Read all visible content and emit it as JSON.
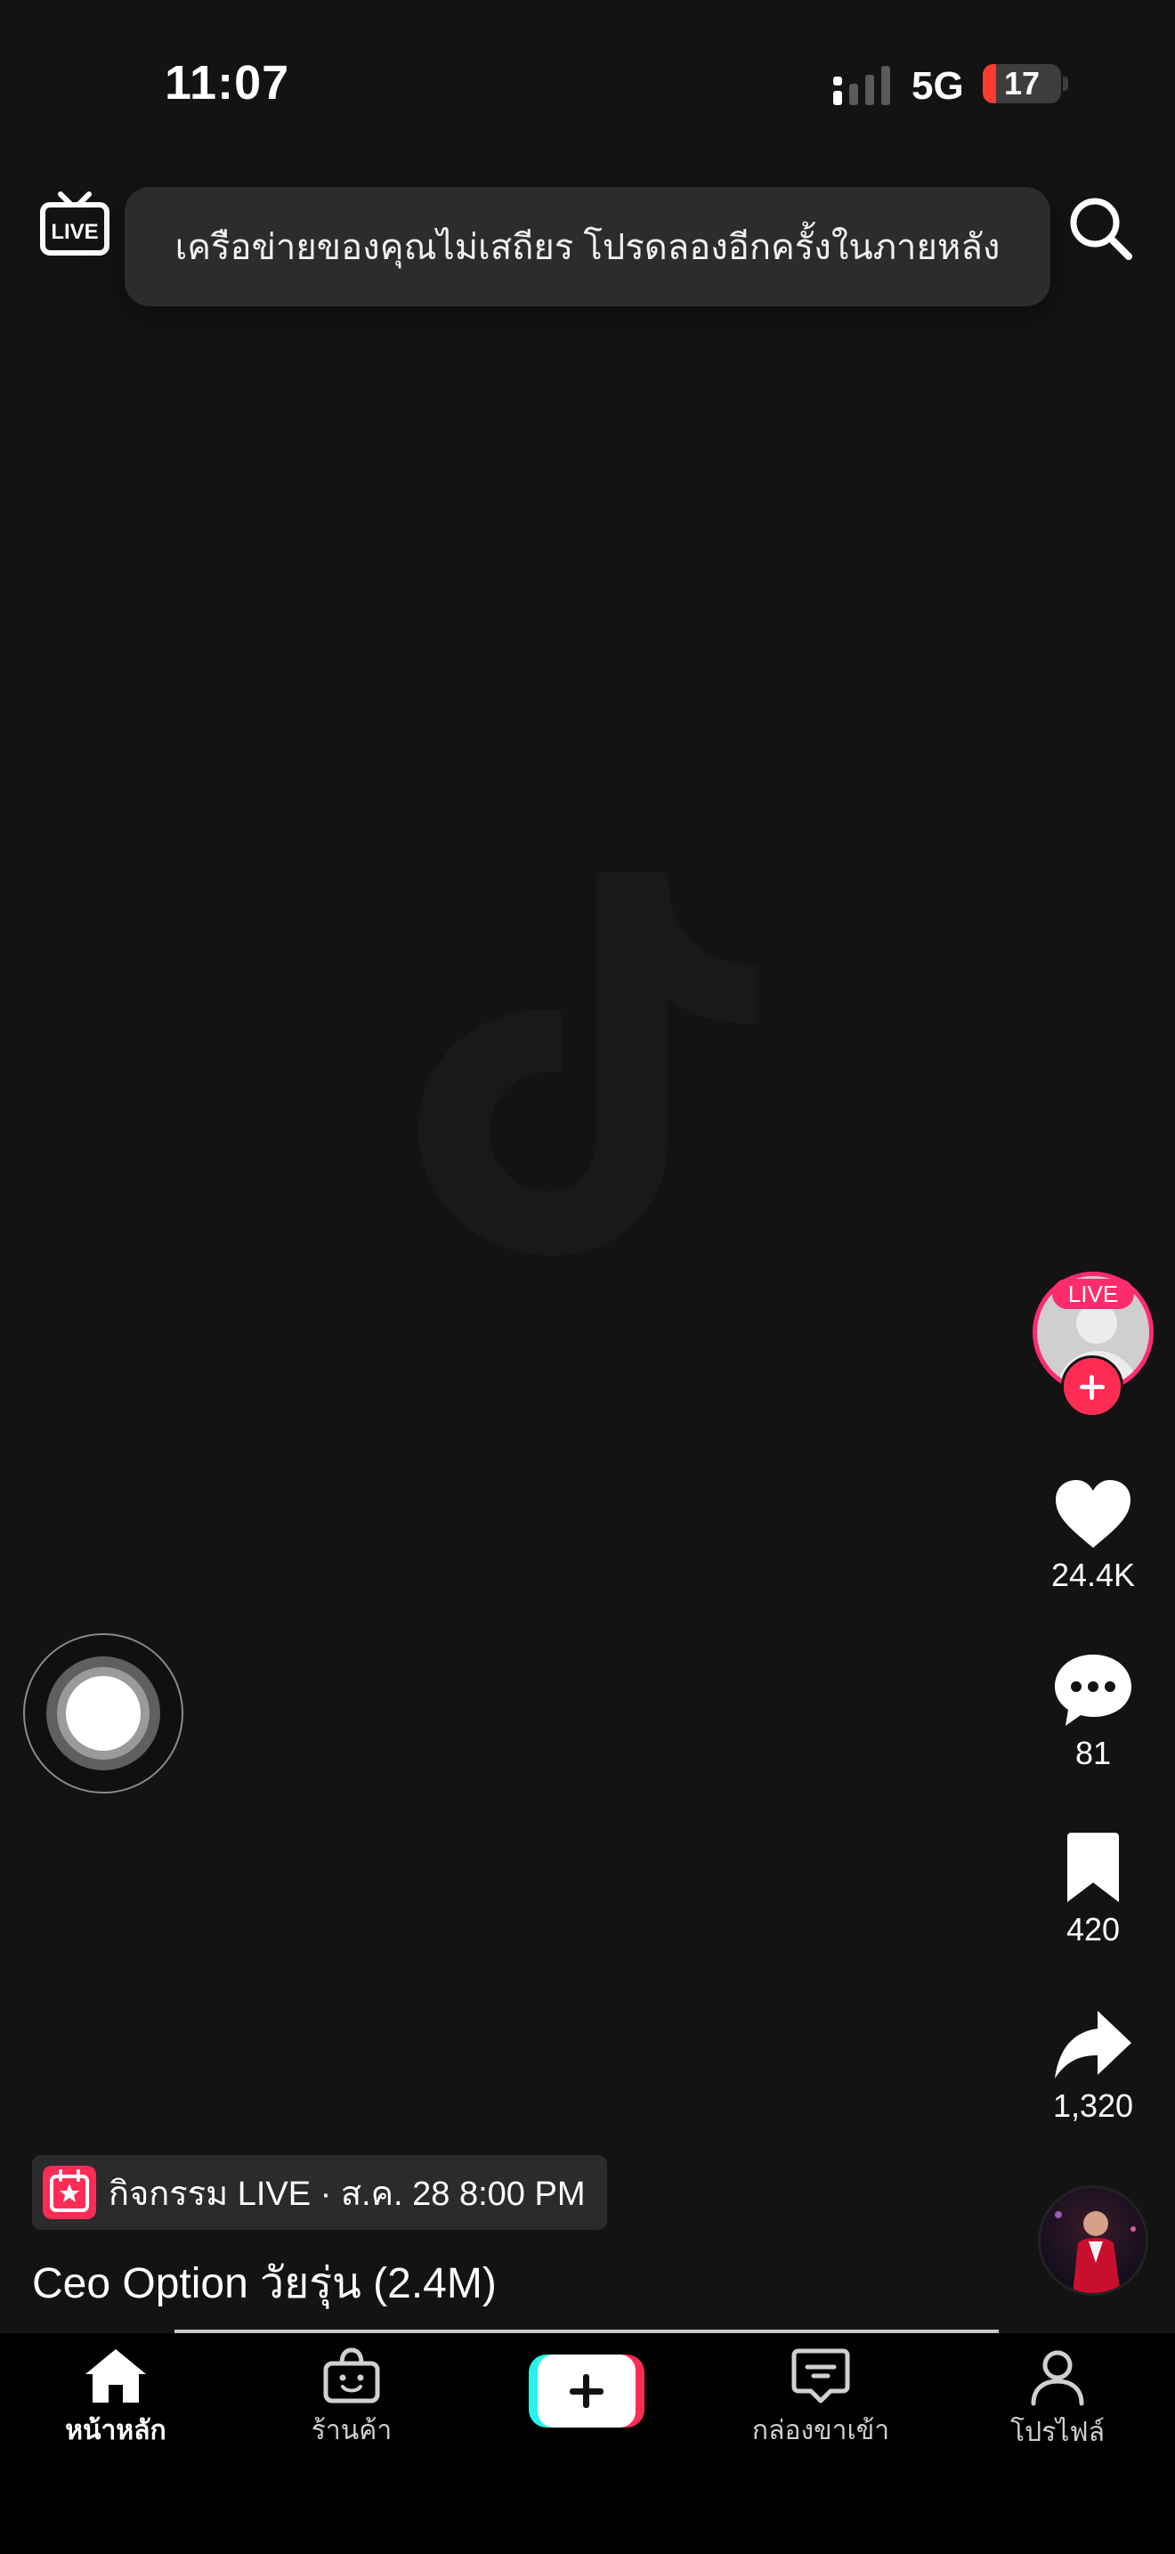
{
  "status_bar": {
    "time": "11:07",
    "network": "5G",
    "battery_level": "17",
    "battery_fraction": 0.17,
    "battery_color": "#ff3b30"
  },
  "top_bar": {
    "live_icon": "live-tv-icon",
    "search_icon": "search-icon",
    "toast_message": "เครือข่ายของคุณไม่เสถียร โปรดลองอีกครั้งในภายหลัง"
  },
  "creator": {
    "live_badge": "LIVE",
    "accent_color": "#fe2c55"
  },
  "actions": {
    "likes": "24.4K",
    "comments": "81",
    "saves": "420",
    "shares": "1,320"
  },
  "video": {
    "event_label": "กิจกรรม LIVE · ส.ค. 28 8:00 PM",
    "caption": "Ceo Option วัยรุ่น (2.4M)",
    "progress_fraction": 1.0
  },
  "bottom_nav": {
    "home": "หน้าหลัก",
    "shop": "ร้านค้า",
    "inbox": "กล่องขาเข้า",
    "profile": "โปรไฟล์"
  }
}
